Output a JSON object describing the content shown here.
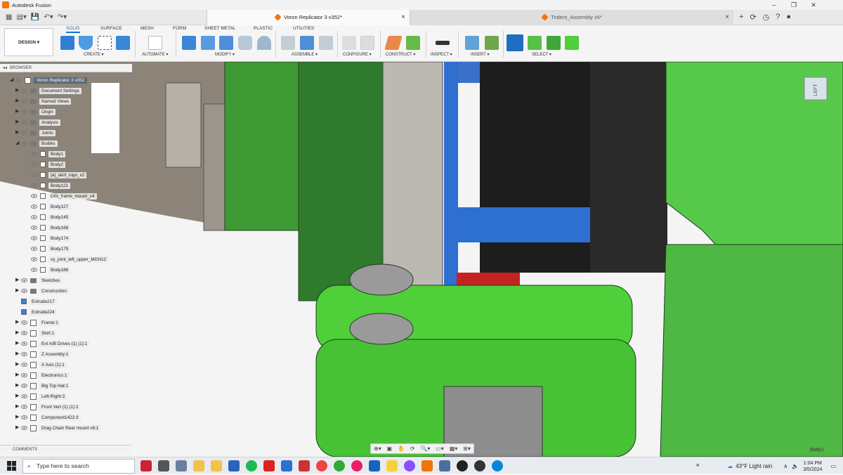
{
  "window": {
    "title": "Autodesk Fusion",
    "minimize": "–",
    "maximize": "❐",
    "close": "✕"
  },
  "tabs": [
    {
      "label": "Voron Replicator 3 v352*",
      "close": "×"
    },
    {
      "label": "Trident_Assembly v5*",
      "close": "×"
    }
  ],
  "tabbar_right": {
    "new": "+",
    "jobs": "⟳",
    "clock": "◷",
    "help": "?",
    "avatar": "●"
  },
  "toolbar": {
    "workspace": "DESIGN ▾",
    "workspace_tabs": [
      "SOLID",
      "SURFACE",
      "MESH",
      "FORM",
      "SHEET METAL",
      "PLASTIC",
      "UTILITIES"
    ],
    "groups": [
      "CREATE ▾",
      "AUTOMATE ▾",
      "MODIFY ▾",
      "ASSEMBLE ▾",
      "CONFIGURE ▾",
      "CONSTRUCT ▾",
      "INSPECT ▾",
      "INSERT ▾",
      "SELECT ▾"
    ]
  },
  "browser": {
    "header": "BROWSER",
    "root": "Voron Replicator 3 v352",
    "items": [
      {
        "label": "Document Settings",
        "indent": 1,
        "kind": "settings",
        "expand": "▶"
      },
      {
        "label": "Named Views",
        "indent": 1,
        "kind": "folder",
        "expand": "▶"
      },
      {
        "label": "Origin",
        "indent": 1,
        "kind": "folder",
        "expand": "▶"
      },
      {
        "label": "Analysis",
        "indent": 1,
        "kind": "folder",
        "expand": "▶"
      },
      {
        "label": "Joints",
        "indent": 1,
        "kind": "folder",
        "expand": "▶"
      },
      {
        "label": "Bodies",
        "indent": 1,
        "kind": "folder",
        "expand": "◢"
      },
      {
        "label": "Body1",
        "indent": 2,
        "kind": "body",
        "expand": ""
      },
      {
        "label": "Body2",
        "indent": 2,
        "kind": "body",
        "expand": ""
      },
      {
        "label": "[a]_skirt_logo_x2",
        "indent": 2,
        "kind": "body",
        "expand": ""
      },
      {
        "label": "Body121",
        "indent": 2,
        "kind": "body",
        "expand": ""
      },
      {
        "label": "DIN_frame_mount_x4",
        "indent": 2,
        "kind": "body",
        "expand": ""
      },
      {
        "label": "Body127",
        "indent": 2,
        "kind": "body",
        "expand": ""
      },
      {
        "label": "Body145",
        "indent": 2,
        "kind": "body",
        "expand": ""
      },
      {
        "label": "Body168",
        "indent": 2,
        "kind": "body",
        "expand": ""
      },
      {
        "label": "Body174",
        "indent": 2,
        "kind": "body",
        "expand": ""
      },
      {
        "label": "Body179",
        "indent": 2,
        "kind": "body",
        "expand": ""
      },
      {
        "label": "xy_joint_left_upper_MGN12",
        "indent": 2,
        "kind": "body",
        "expand": ""
      },
      {
        "label": "Body186",
        "indent": 2,
        "kind": "body",
        "expand": ""
      },
      {
        "label": "Sketches",
        "indent": 1,
        "kind": "folder",
        "expand": "▶"
      },
      {
        "label": "Construction",
        "indent": 1,
        "kind": "folder",
        "expand": "▶"
      },
      {
        "label": "Extrude217",
        "indent": 1,
        "kind": "feature",
        "expand": ""
      },
      {
        "label": "Extrude224",
        "indent": 1,
        "kind": "feature",
        "expand": ""
      },
      {
        "label": "Frame:1",
        "indent": 1,
        "kind": "comp",
        "expand": "▶"
      },
      {
        "label": "Skirt:1",
        "indent": 1,
        "kind": "comp",
        "expand": "▶"
      },
      {
        "label": "Ext A/B Drives (1) (1):1",
        "indent": 1,
        "kind": "comp",
        "expand": "▶"
      },
      {
        "label": "Z Assembly:1",
        "indent": 1,
        "kind": "comp",
        "expand": "▶"
      },
      {
        "label": "X Axis (1):1",
        "indent": 1,
        "kind": "comp",
        "expand": "▶"
      },
      {
        "label": "Electronics:1",
        "indent": 1,
        "kind": "comp",
        "expand": "▶"
      },
      {
        "label": "Big Top Hat:1",
        "indent": 1,
        "kind": "comp",
        "expand": "▶"
      },
      {
        "label": "Left-Right:3",
        "indent": 1,
        "kind": "comp",
        "expand": "▶"
      },
      {
        "label": "Front Vert (1) (1):1",
        "indent": 1,
        "kind": "comp",
        "expand": "▶"
      },
      {
        "label": "Component1422:3",
        "indent": 1,
        "kind": "comp",
        "expand": "▶"
      },
      {
        "label": "Drag Chain Rear mount v8:1",
        "indent": 1,
        "kind": "link",
        "expand": "▶"
      }
    ]
  },
  "comments": {
    "label": "COMMENTS"
  },
  "viewcube": {
    "label": "LEFT"
  },
  "viewport": {
    "selection_label": "Body1"
  },
  "navbar": [
    "⊕▾",
    "▣",
    "✋",
    "⟳",
    "🔍▾",
    "▭▾",
    "▦▾",
    "⊞▾"
  ],
  "taskbar": {
    "search_placeholder": "Type here to search",
    "weather": "43°F  Light rain",
    "time": "1:04 PM",
    "date": "3/5/2024"
  },
  "colors": {
    "accent": "#1a73c7",
    "model_green": "#4fcf3a",
    "dark_green": "#3a8a30",
    "blue_part": "#2f6fd0"
  }
}
